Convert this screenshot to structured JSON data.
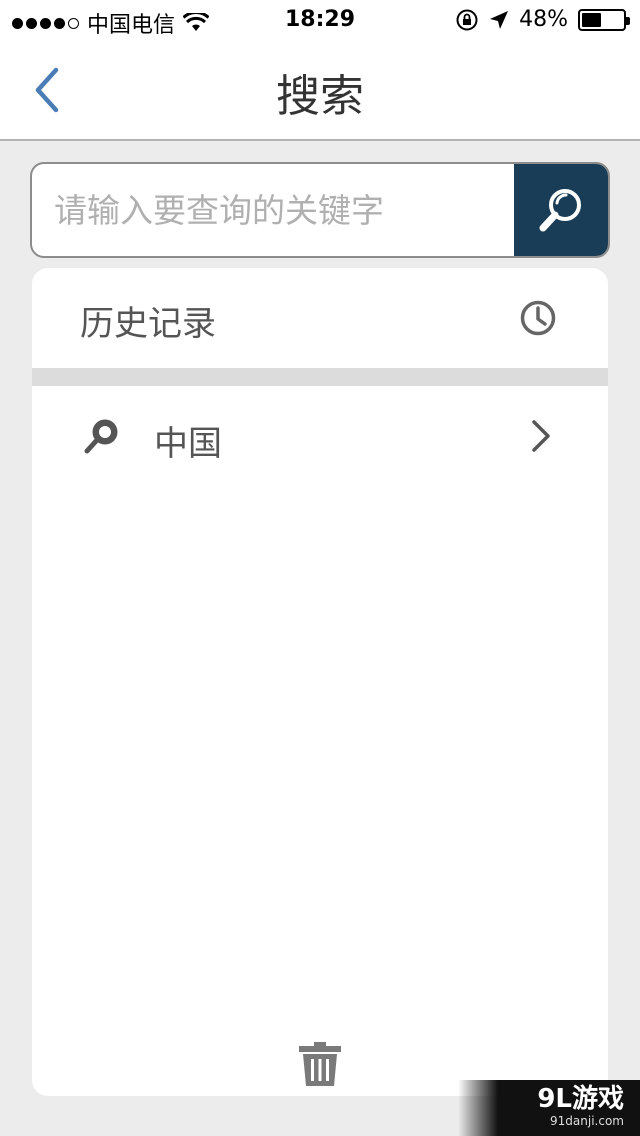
{
  "status_bar": {
    "carrier": "中国电信",
    "time": "18:29",
    "battery_text": "48%",
    "battery_level": 0.48,
    "signal_bars_filled": 4,
    "signal_bars_total": 5
  },
  "nav": {
    "title": "搜索",
    "back_icon": "chevron-left-icon"
  },
  "search": {
    "placeholder": "请输入要查询的关键字",
    "value": "",
    "button_icon": "search-icon"
  },
  "history": {
    "title": "历史记录",
    "header_icon": "clock-icon",
    "items": [
      {
        "label": "中国",
        "icon": "search-icon",
        "trailing_icon": "chevron-right-icon"
      }
    ],
    "clear_icon": "trash-icon"
  },
  "watermark": {
    "logo": "9L游戏",
    "url": "91danji.com"
  },
  "colors": {
    "accent": "#1a3d57",
    "back_arrow": "#4a7cb5",
    "page_bg": "#ececec"
  }
}
